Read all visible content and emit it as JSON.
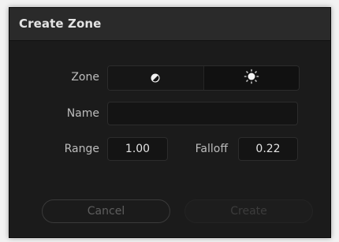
{
  "dialog": {
    "title": "Create Zone"
  },
  "zone": {
    "label": "Zone",
    "options": [
      {
        "icon": "half-circle-shadow-icon",
        "selected": true
      },
      {
        "icon": "highlight-sun-icon",
        "selected": false
      }
    ]
  },
  "name": {
    "label": "Name",
    "value": ""
  },
  "range": {
    "label": "Range",
    "value": "1.00"
  },
  "falloff": {
    "label": "Falloff",
    "value": "0.22"
  },
  "buttons": {
    "cancel": "Cancel",
    "create": "Create"
  }
}
